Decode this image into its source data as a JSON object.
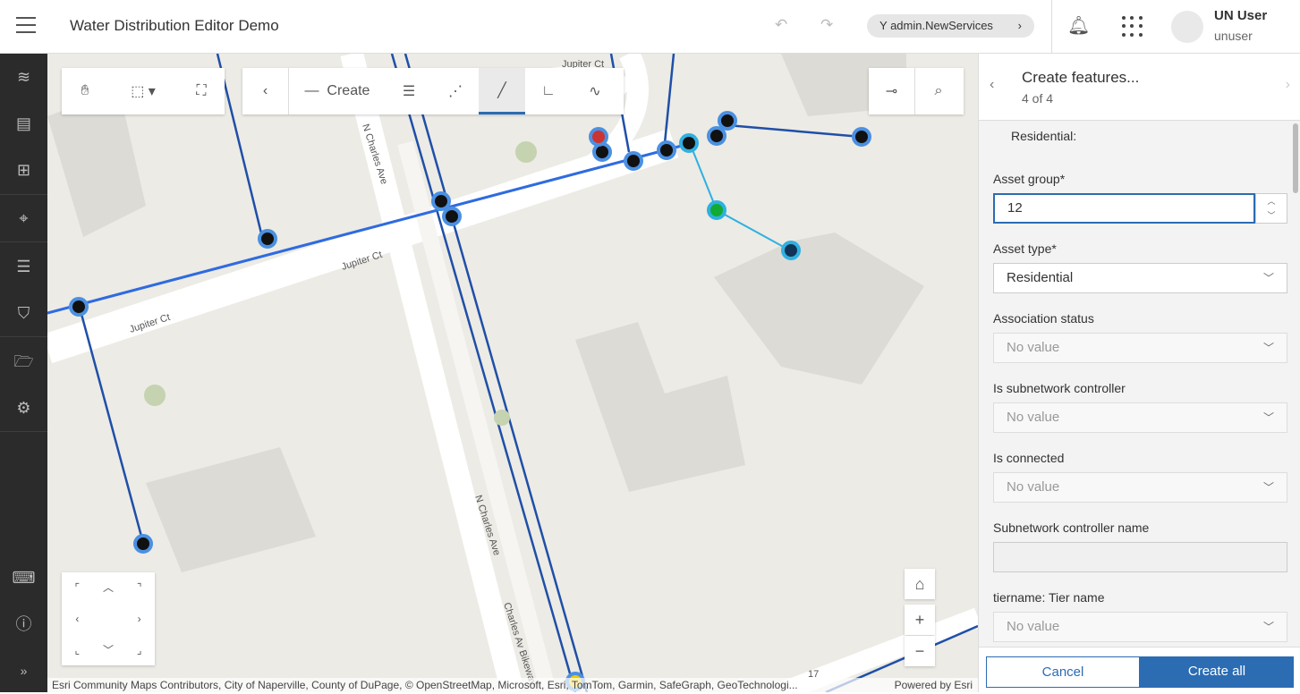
{
  "header": {
    "title": "Water Distribution Editor Demo",
    "branch": "admin.NewServices",
    "user_name": "UN User",
    "user_login": "unuser"
  },
  "sidebar": {
    "items": [
      "layers-icon",
      "table-icon",
      "widgets-icon",
      "select-icon",
      "list-icon",
      "bookmark-icon",
      "folder-icon",
      "gear-icon",
      "keyboard-icon",
      "info-icon",
      "expand-icon"
    ]
  },
  "toolbar": {
    "create_label": "Create"
  },
  "map": {
    "labels": {
      "jupiter1": "Jupiter Ct",
      "jupiter2": "Jupiter Ct",
      "jupiter3": "Jupiter Ct",
      "charles1": "N Charles Ave",
      "charles2": "N Charles Ave",
      "bikeway": "Charles Av Bikeway",
      "route": "17"
    },
    "attribution": "Esri Community Maps Contributors, City of Naperville, County of DuPage, © OpenStreetMap, Microsoft, Esri, TomTom, Garmin, SafeGraph, GeoTechnologi...",
    "powered": "Powered by Esri",
    "line_color": "#1f4fa8",
    "selected_color": "#2fb0e0"
  },
  "panel": {
    "title": "Create features...",
    "subtitle": "4 of 4",
    "section": "Residential:",
    "fields": [
      {
        "label": "Asset group*",
        "value": "12"
      },
      {
        "label": "Asset type*",
        "value": "Residential"
      },
      {
        "label": "Association status",
        "value": "No value"
      },
      {
        "label": "Is subnetwork controller",
        "value": "No value"
      },
      {
        "label": "Is connected",
        "value": "No value"
      },
      {
        "label": "Subnetwork controller name",
        "value": ""
      },
      {
        "label": "tiername: Tier name",
        "value": "No value"
      }
    ],
    "cancel": "Cancel",
    "create_all": "Create all",
    "accent": "#2b6cb3"
  }
}
